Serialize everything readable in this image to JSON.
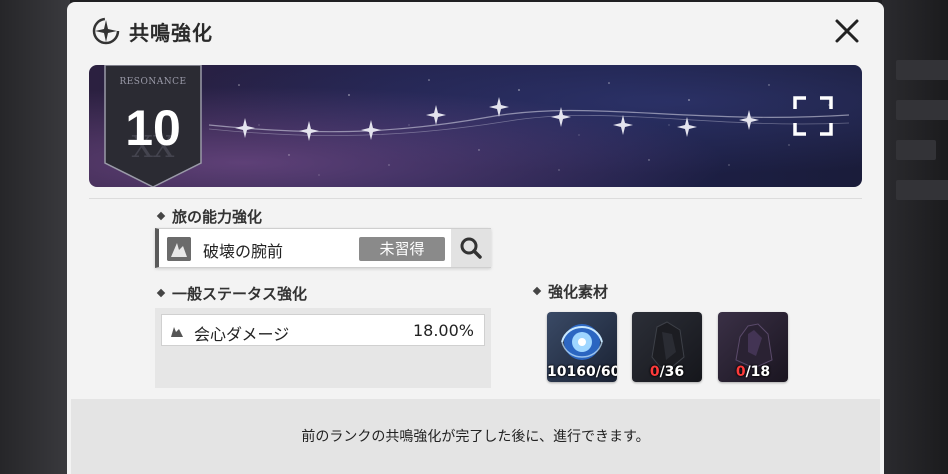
{
  "dialog": {
    "title": "共鳴強化",
    "close_icon": "close-icon",
    "logo_icon": "compass-star-icon"
  },
  "banner": {
    "rank_label": "RESONANCE",
    "rank_value": "10",
    "expand_icon": "expand-corners-icon"
  },
  "skill_section": {
    "heading": "旅の能力強化",
    "skill_name": "破壊の腕前",
    "status": "未習得",
    "search_icon": "search-icon"
  },
  "stat_section": {
    "heading": "一般ステータス強化",
    "stat_name": "会心ダメージ",
    "stat_value": "18.00%"
  },
  "materials_section": {
    "heading": "強化素材",
    "items": [
      {
        "have": "10160",
        "need": "/60",
        "enough": true
      },
      {
        "have": "0",
        "need": "/36",
        "enough": false
      },
      {
        "have": "0",
        "need": "/18",
        "enough": false
      }
    ]
  },
  "footer": {
    "message": "前のランクの共鳴強化が完了した後に、進行できます。"
  },
  "colors": {
    "insufficient": "#ff3b3b",
    "dialog_bg": "#f3f3f3",
    "banner_bg": "#22214a"
  }
}
